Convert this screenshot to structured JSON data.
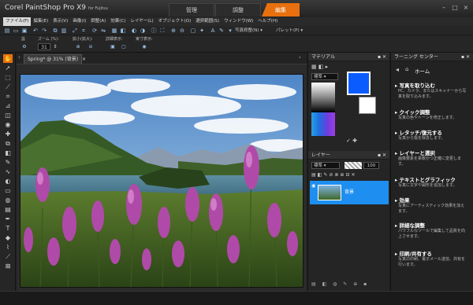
{
  "app": {
    "title": "Corel PaintShop Pro X9",
    "sub": "for Fujitsu",
    "tabs": [
      "管理",
      "調整",
      "編集"
    ],
    "active_tab": "編集",
    "accent": "#e8700e"
  },
  "menu": [
    "ファイル(F)",
    "編集(E)",
    "表示(V)",
    "画像(I)",
    "調整(A)",
    "効果(C)",
    "レイヤー(L)",
    "オブジェクト(O)",
    "選択範囲(S)",
    "ウィンドウ(W)",
    "ヘルプ(H)"
  ],
  "toolbar": {
    "workspace_label": "写真修整(N)",
    "palette_label": "パレット(P)"
  },
  "tool_options": {
    "preset_label": "設",
    "zoom_label": "ズーム (%):",
    "zoom_value": "31",
    "zoomstep_label": "拡小(拡大):",
    "detail_label": "詳細表示:",
    "actual_label": "実寸表示:"
  },
  "document": {
    "tab_title": "Spring* @ 31% (背景)"
  },
  "materials": {
    "title": "マテリアル",
    "mode": "標準",
    "fg_color": "#0a5cff",
    "bg_color": "#ffffff"
  },
  "layers": {
    "title": "レイヤー",
    "blend": "標準",
    "opacity": "100",
    "items": [
      {
        "name": "背景"
      }
    ]
  },
  "learning": {
    "title": "ラーニング センター",
    "home": "ホーム",
    "items": [
      {
        "title": "写真を取り込む",
        "desc": "PC、カメラ、またはスキャナーから写真を取り込みます。"
      },
      {
        "title": "クイック調整",
        "desc": "写真の色やトーンを修正します。"
      },
      {
        "title": "レタッチ/復元する",
        "desc": "写真から傷を除去します。"
      },
      {
        "title": "レイヤーと選択",
        "desc": "画像要素を柔軟かつ正確に変更します。"
      },
      {
        "title": "テキストとグラフィック",
        "desc": "写真に文字や図形を追加します。"
      },
      {
        "title": "効果",
        "desc": "写真にアーティスティック効果を加えます。"
      },
      {
        "title": "詳細な調整",
        "desc": "パワフルなツールで編集して品質を向上させます。"
      },
      {
        "title": "印刷/共有する",
        "desc": "写真の印刷、電子メール送信、共有を行います。"
      }
    ]
  }
}
